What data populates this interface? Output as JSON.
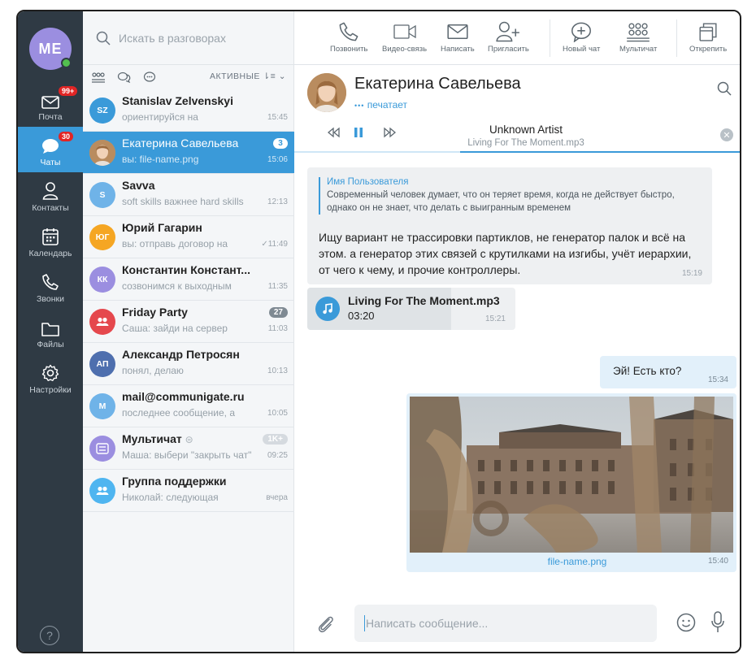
{
  "user": {
    "initials": "ME",
    "online": true
  },
  "rail": {
    "items": [
      {
        "label": "Почта",
        "icon": "mail-icon",
        "badge": "99+"
      },
      {
        "label": "Чаты",
        "icon": "chat-bubble-icon",
        "badge": "30",
        "active": true
      },
      {
        "label": "Контакты",
        "icon": "person-icon"
      },
      {
        "label": "Календарь",
        "icon": "calendar-icon"
      },
      {
        "label": "Звонки",
        "icon": "phone-icon"
      },
      {
        "label": "Файлы",
        "icon": "folder-icon"
      },
      {
        "label": "Настройки",
        "icon": "gear-icon"
      }
    ],
    "help": "?"
  },
  "search": {
    "placeholder": "Искать в разговорах"
  },
  "filter": {
    "label": "АКТИВНЫЕ"
  },
  "chats": [
    {
      "initials": "SZ",
      "color": "#3a9ad9",
      "name": "Stanislav Zelvenskyi",
      "preview": "ориентируйся на",
      "time": "15:45",
      "badge": ""
    },
    {
      "initials": "",
      "color": "#c9a67f",
      "name": "Екатерина Савельева",
      "preview": "вы: file-name.png",
      "time": "15:06",
      "badge": "3",
      "active": true
    },
    {
      "initials": "S",
      "color": "#6fb3e8",
      "name": "Savva",
      "preview": "soft skills важнее hard skills",
      "time": "12:13",
      "badge": ""
    },
    {
      "initials": "ЮГ",
      "color": "#f5a623",
      "name": "Юрий Гагарин",
      "preview": "вы: отправь договор на",
      "time": "✓11:49",
      "badge": ""
    },
    {
      "initials": "КК",
      "color": "#9b8ee0",
      "name": "Константин Констант...",
      "preview": "созвонимся к выходным",
      "time": "11:35",
      "badge": ""
    },
    {
      "initials": "",
      "color": "#e5484d",
      "name": "Friday Party",
      "preview": "Саша: зайди на сервер",
      "time": "11:03",
      "badge": "27"
    },
    {
      "initials": "АП",
      "color": "#4e6fae",
      "name": "Александр Петросян",
      "preview": "понял, делаю",
      "time": "10:13",
      "badge": ""
    },
    {
      "initials": "M",
      "color": "#6fb3e8",
      "name": "mail@communigate.ru",
      "preview": "последнее сообщение, а",
      "time": "10:05",
      "badge": ""
    },
    {
      "initials": "",
      "color": "#9b8ee0",
      "name": "Мультичат",
      "preview": "Маша: выбери \"закрыть чат\"",
      "time": "09:25",
      "badge": "1K+"
    },
    {
      "initials": "",
      "color": "#4fb5f0",
      "name": "Группа поддержки",
      "preview": "Николай: следующая",
      "time": "вчера",
      "badge": ""
    }
  ],
  "toolbar": {
    "call": "Позвонить",
    "video": "Видео-связь",
    "write": "Написать",
    "invite": "Пригласить",
    "new_chat": "Новый чат",
    "multichat": "Мультичат",
    "unpin": "Открепить"
  },
  "header": {
    "name": "Екатерина Савельева",
    "status": "печатает"
  },
  "player": {
    "artist": "Unknown Artist",
    "track": "Living For The Moment.mp3",
    "progress": 0.37
  },
  "messages": {
    "quote_author": "Имя Пользователя",
    "quote_text": "Современный человек думает, что он теряет время, когда не действует быстро, однако он не знает, что делать с выигранным временем",
    "text": "Ищу вариант не трассировки партиклов, не генератор палок и всё на этом. а генератор этих связей с крутилками на изгибы, учёт иерархии, от чего к чему, и прочие контроллеры.",
    "text_time": "15:19",
    "audio_title": "Living For The Moment.mp3",
    "audio_duration": "03:20",
    "audio_time": "15:21",
    "audio_progress": 0.69,
    "out_text": "Эй! Есть кто?",
    "out_time": "15:34",
    "image_caption": "file-name.png",
    "image_time": "15:40"
  },
  "composer": {
    "placeholder": "Написать сообщение..."
  }
}
